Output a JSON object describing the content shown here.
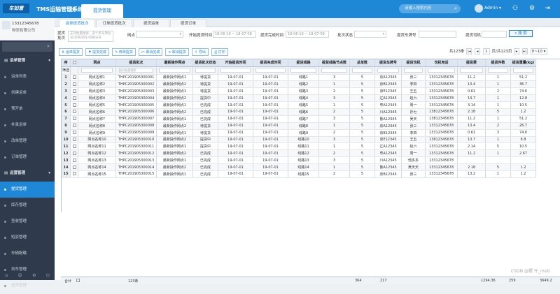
{
  "app": {
    "logo": "车如意",
    "system_name": "TMS运输管理系统",
    "home_tab": "首页",
    "active_tab": "提货管理",
    "search_placeholder": "请输入搜索内容",
    "user": "Admin"
  },
  "sidebar": {
    "phone": "13312345678",
    "company": "物流有限公司",
    "items": [
      {
        "label": "运单管理",
        "type": "group"
      },
      {
        "label": "运单列表",
        "type": "item"
      },
      {
        "label": "创建运单",
        "type": "item"
      },
      {
        "label": "预开单",
        "type": "item"
      },
      {
        "label": "补录运单",
        "type": "item"
      },
      {
        "label": "改单管理",
        "type": "item"
      },
      {
        "label": "订单管理",
        "type": "item"
      },
      {
        "label": "运营管理",
        "type": "group"
      },
      {
        "label": "提货管理",
        "type": "item",
        "active": true
      },
      {
        "label": "库存管理",
        "type": "item"
      },
      {
        "label": "签收管理",
        "type": "item"
      },
      {
        "label": "短驳管理",
        "type": "item"
      },
      {
        "label": "车辆配载",
        "type": "item"
      },
      {
        "label": "到车管理",
        "type": "item"
      },
      {
        "label": "送货管理",
        "type": "item"
      }
    ]
  },
  "subtabs": [
    "运单提货批次",
    "订单提货批次",
    "提货运单",
    "提货订单"
  ],
  "filter": {
    "batch_label": "提货批次",
    "batch_placeholder": "支持批量搜索、多个单号用逗号/空格/回车/空格分开",
    "site_label": "网点",
    "start_label": "开始提货时间",
    "start_value": "18-06-19 ~ 18-07-08",
    "finish_label": "提货完成时间",
    "finish_value": "18-06-19 ~ 18-07-08",
    "status_label": "批次状态",
    "plate_label": "提货车牌号",
    "driver_label": "提货司机",
    "search_btn": "搜 索"
  },
  "toolbar": {
    "buttons": [
      "运单提货",
      "提货完成",
      "修改提货",
      "取消完成",
      "取消提货",
      "导出",
      "打印"
    ],
    "page_total": "共123条",
    "page_input": "1",
    "page_text": "页/共123页",
    "page_size": "0~10"
  },
  "columns": [
    "序",
    "",
    "网点",
    "提货批次",
    "最新操作网点",
    "提货批次状态",
    "开始提货时间",
    "提货完成时间",
    "提货线路",
    "提货线路节点数",
    "总单数",
    "提货车牌号",
    "提货司机",
    "司机电话",
    "提货费",
    "提货件数",
    "提货重量(kg)"
  ],
  "filter_row_label": "筛选",
  "filter_row_placeholder": "支持批量搜索",
  "rows": [
    [
      "1",
      "",
      "网点名称1",
      "THPC201905300001",
      "最新操作网点1",
      "待提货",
      "19-07-01",
      "19-07-01",
      "线路1",
      "3",
      "5",
      "京A12345",
      "张三",
      "13312345678",
      "11.2",
      "1",
      "51.2"
    ],
    [
      "2",
      "",
      "网点名称2",
      "THPC201905300002",
      "最新操作网点2",
      "待提货",
      "19-07-01",
      "19-07-01",
      "线路2",
      "1",
      "5",
      "京B12345",
      "李四",
      "13312345678",
      "13.4",
      "1",
      "36.7"
    ],
    [
      "3",
      "",
      "网点名称3",
      "THPC201905300003",
      "最新操作网点1",
      "待提货",
      "19-07-01",
      "19-07-01",
      "线路3",
      "2",
      "5",
      "京E12345",
      "王五",
      "13312345678",
      "0.61",
      "2",
      "74.6"
    ],
    [
      "4",
      "",
      "网点名称4",
      "THPC201905300004",
      "最新操作网点2",
      "提货中",
      "19-07-01",
      "19-07-01",
      "线路4",
      "3",
      "5",
      "辽A12345",
      "赵六",
      "13312345678",
      "13.7",
      "1",
      "12.8"
    ],
    [
      "5",
      "",
      "网点名称5",
      "THPC201905300005",
      "最新操作网点1",
      "已完成",
      "19-07-01",
      "19-07-01",
      "线路5",
      "1",
      "5",
      "粤A12345",
      "周一",
      "13312345678",
      "3.14",
      "1",
      "10.5"
    ],
    [
      "6",
      "",
      "网点名称6",
      "THPC201905300006",
      "最新操作网点2",
      "已完成",
      "19-07-01",
      "19-07-01",
      "线路6",
      "2",
      "5",
      "川A12345",
      "孙七",
      "13812345678",
      "2.18",
      "5",
      "1.2"
    ],
    [
      "7",
      "",
      "网点名称7",
      "THPC201905300007",
      "最新操作网点1",
      "已完成",
      "19-07-01",
      "19-07-01",
      "线路7",
      "3",
      "5",
      "鲁A12345",
      "吴天",
      "13812345678",
      "11.2",
      "1",
      "51.2"
    ],
    [
      "8",
      "",
      "网点名称8",
      "THPC201905300008",
      "最新操作网点2",
      "待提货",
      "19-07-01",
      "19-07-01",
      "线路8",
      "1",
      "5",
      "京A12345",
      "张三",
      "13312345678",
      "13.4",
      "2",
      "26.7"
    ],
    [
      "9",
      "",
      "网点名称9",
      "THPC201905300009",
      "最新操作网点1",
      "待提货",
      "19-07-01",
      "19-07-01",
      "线路9",
      "2",
      "5",
      "京B12345",
      "李四",
      "13312345678",
      "0.61",
      "3",
      "74.6"
    ],
    [
      "10",
      "",
      "网点名称10",
      "THPC201905300010",
      "最新操作网点2",
      "提货中",
      "19-07-01",
      "19-07-01",
      "线路10",
      "3",
      "5",
      "京E12345",
      "王五",
      "13812345678",
      "13.7",
      "1",
      "6.8"
    ],
    [
      "11",
      "",
      "网点名称11",
      "THPC201905300011",
      "最新操作网点1",
      "提货中",
      "19-07-01",
      "19-07-01",
      "线路11",
      "1",
      "5",
      "辽A12345",
      "赵六",
      "13312345678",
      "2.14",
      "5",
      "10.5"
    ],
    [
      "12",
      "",
      "网点名称12",
      "THPC201905300012",
      "最新操作网点2",
      "已完成",
      "19-07-01",
      "19-07-01",
      "线路12",
      "2",
      "5",
      "粤A12345",
      "周一",
      "13312345678",
      "11.2",
      "1",
      "2.67"
    ],
    [
      "13",
      "",
      "网点名称13",
      "THPC201905300013",
      "最新操作网点1",
      "已完成",
      "19-07-01",
      "19-07-01",
      "线路13",
      "3",
      "5",
      "川A12345",
      "他多多",
      "13312345678",
      "",
      "",
      ""
    ],
    [
      "14",
      "",
      "网点名称14",
      "THPC201905300014",
      "最新操作网点2",
      "已完成",
      "19-07-01",
      "19-07-01",
      "线路14",
      "1",
      "5",
      "鲁A12345",
      "吴天天",
      "13312345678",
      "2.18",
      "5",
      "1.2"
    ],
    [
      "15",
      "",
      "网点名称15",
      "THPC201905300015",
      "最新操作网点1",
      "已完成",
      "19-07-01",
      "19-07-01",
      "线路15",
      "2",
      "5",
      "京B12345",
      "张三",
      "13312345678",
      "13.2",
      "1",
      "1.2"
    ]
  ],
  "totals": {
    "label": "合计",
    "count": "123条",
    "nodes": "364",
    "orders": "217",
    "fee": "1294.36",
    "pieces": "259",
    "weight": "3649.2"
  },
  "watermark": "CSDN @猩 令_mski"
}
